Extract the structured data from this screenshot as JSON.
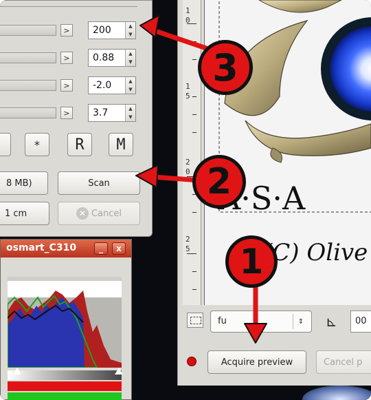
{
  "scanner_panel": {
    "rows": [
      {
        "value": "200",
        "slider_fill": 0.0
      },
      {
        "value": "0.88",
        "slider_fill": 0.0
      },
      {
        "value": "-2.0",
        "slider_fill": 0.0
      },
      {
        "value": "3.7",
        "slider_fill": 0.0
      }
    ],
    "arrow_glyph": ">",
    "tool_buttons": [
      "*",
      "R",
      "M"
    ],
    "size_label": "8 MB)",
    "scan_label": "Scan",
    "dimension_label": "1 cm",
    "cancel_label": "Cancel"
  },
  "histogram_window": {
    "title": "osmart_C310",
    "minimize_label": "_",
    "close_label": "x"
  },
  "preview_window": {
    "ruler_labels": [
      "1",
      "0",
      "1",
      "5",
      "2",
      "0",
      "2",
      "5"
    ],
    "image_text_line1": "A·S·A",
    "image_text_line2": "(C) Olive",
    "format_value": "fu",
    "number_field_value": "00",
    "acquire_label": "Acquire preview",
    "cancel_preview_label": "Cancel p"
  },
  "annotations": {
    "step1": "1",
    "step2": "2",
    "step3": "3",
    "arrow_color": "#e01414",
    "badge_color": "#e01414"
  }
}
